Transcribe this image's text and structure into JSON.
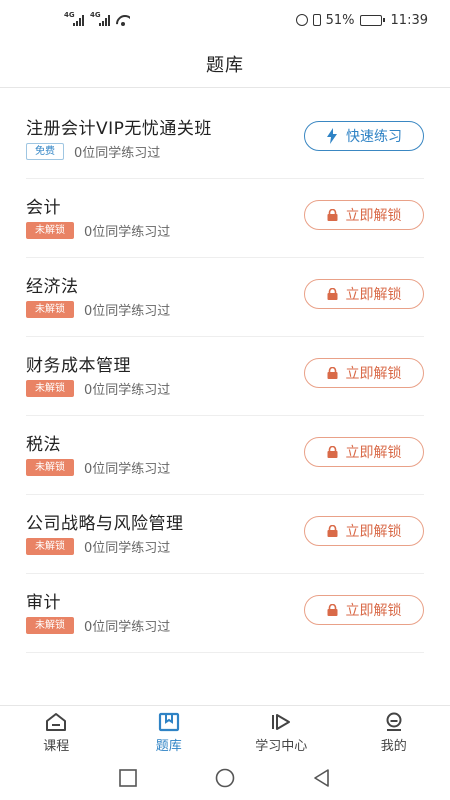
{
  "status_bar": {
    "signal_1_tag": "4G",
    "signal_2_tag": "4G",
    "battery_percent": "51%",
    "battery_level": 0.51,
    "time": "11:39"
  },
  "header": {
    "title": "题库"
  },
  "items": [
    {
      "name": "注册会计VIP无忧通关班",
      "badge": "免费",
      "count": "0位同学练习过",
      "action": "快速练习",
      "state": "free"
    },
    {
      "name": "会计",
      "badge": "未解锁",
      "count": "0位同学练习过",
      "action": "立即解锁",
      "state": "locked"
    },
    {
      "name": "经济法",
      "badge": "未解锁",
      "count": "0位同学练习过",
      "action": "立即解锁",
      "state": "locked"
    },
    {
      "name": "财务成本管理",
      "badge": "未解锁",
      "count": "0位同学练习过",
      "action": "立即解锁",
      "state": "locked"
    },
    {
      "name": "税法",
      "badge": "未解锁",
      "count": "0位同学练习过",
      "action": "立即解锁",
      "state": "locked"
    },
    {
      "name": "公司战略与风险管理",
      "badge": "未解锁",
      "count": "0位同学练习过",
      "action": "立即解锁",
      "state": "locked"
    },
    {
      "name": "审计",
      "badge": "未解锁",
      "count": "0位同学练习过",
      "action": "立即解锁",
      "state": "locked"
    }
  ],
  "tabs": [
    {
      "label": "课程",
      "icon": "home-icon",
      "active": false
    },
    {
      "label": "题库",
      "icon": "book-icon",
      "active": true
    },
    {
      "label": "学习中心",
      "icon": "play-icon",
      "active": false
    },
    {
      "label": "我的",
      "icon": "profile-icon",
      "active": false
    }
  ],
  "colors": {
    "primary_blue": "#2f83c5",
    "unlock_orange": "#e98365",
    "text": "#222222"
  }
}
